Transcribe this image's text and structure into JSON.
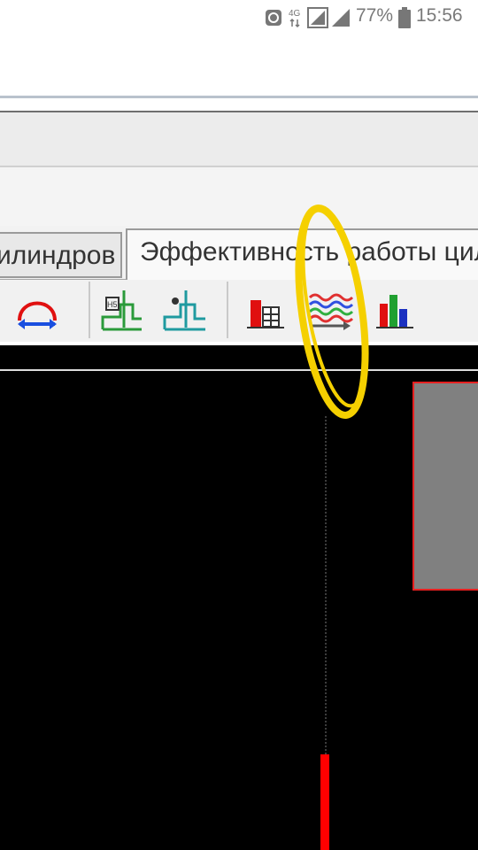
{
  "status_bar": {
    "network": "4G",
    "battery_percent": "77%",
    "time": "15:56",
    "icons": [
      "data-saver-icon",
      "signal-4g-icon",
      "signal-icon",
      "battery-icon"
    ]
  },
  "tabs": [
    {
      "label": "илиндров",
      "active": false
    },
    {
      "label": "Эффективность работы цил",
      "active": true
    }
  ],
  "toolbar": {
    "buttons": [
      {
        "icon": "cylinder-expansion-icon"
      },
      {
        "icon": "green-pv-diagram-icon"
      },
      {
        "icon": "teal-pv-diagram-icon"
      },
      {
        "icon": "bar-table-chart-icon"
      },
      {
        "icon": "wave-signals-icon"
      },
      {
        "icon": "multicolor-bar-chart-icon"
      }
    ]
  },
  "colors": {
    "chart_background": "#000000",
    "highlight": "#f5d000",
    "red_bar": "#ff0000",
    "gray_block": "#808080",
    "gray_block_border": "#e62020"
  }
}
